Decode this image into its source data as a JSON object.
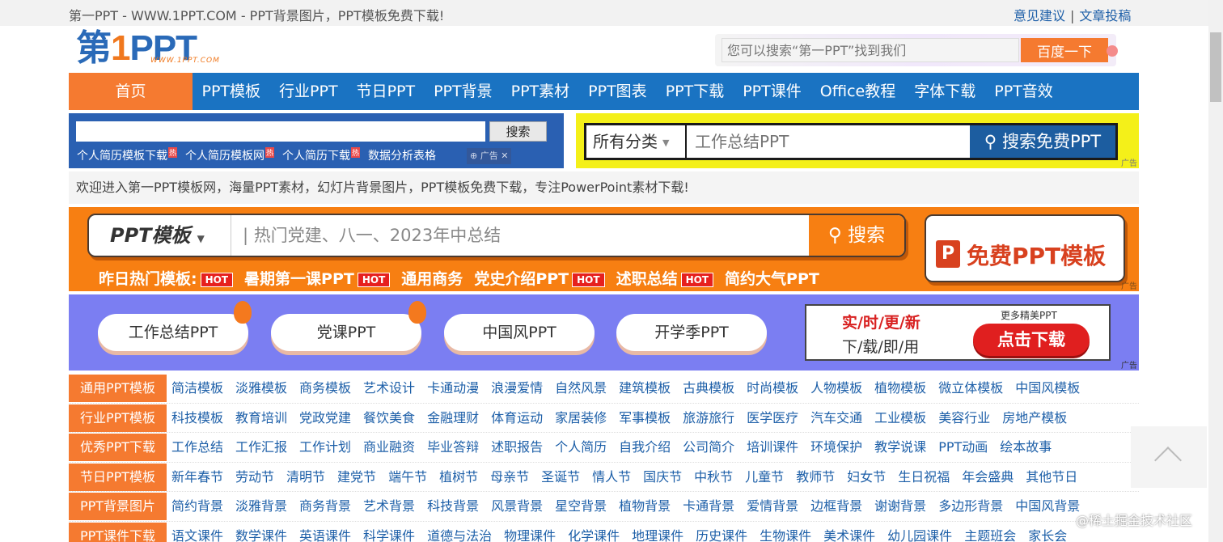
{
  "topbar": {
    "title": "第一PPT - WWW.1PPT.COM - PPT背景图片，PPT模板免费下载!",
    "link_feedback": "意见建议",
    "separator": "|",
    "link_submit": "文章投稿"
  },
  "logo": {
    "part1": "第",
    "part2": "1",
    "part3": "PPT",
    "sub": "WWW.1PPT.COM"
  },
  "header_search": {
    "placeholder": "您可以搜索“第一PPT”找到我们",
    "button": "百度一下"
  },
  "nav": {
    "home": "首页",
    "items": [
      "PPT模板",
      "行业PPT",
      "节日PPT",
      "PPT背景",
      "PPT素材",
      "PPT图表",
      "PPT下载",
      "PPT课件",
      "Office教程",
      "字体下载",
      "PPT音效"
    ]
  },
  "site_search": {
    "button": "搜索",
    "links": [
      "个人简历模板下载",
      "个人简历模板网",
      "个人简历下载",
      "数据分析表格"
    ],
    "hot_mark": "热",
    "ad_label": "广告",
    "ad_close": "✕"
  },
  "yellow_search": {
    "category": "所有分类",
    "placeholder": "工作总结PPT",
    "button": "搜索免费PPT",
    "ad": "广告"
  },
  "welcome": "欢迎进入第一PPT模板网，海量PPT素材，幻灯片背景图片，PPT模板免费下载，专注PowerPoint素材下载!",
  "orange_banner": {
    "category": "PPT模板",
    "placeholder": "热门党建、八一、2023年中总结",
    "button": "搜索",
    "hot_label": "昨日热门模板:",
    "hot_tag": "HOT",
    "hot_items": [
      "暑期第一课PPT",
      "通用商务",
      "党史介绍PPT",
      "述职总结",
      "简约大气PPT"
    ],
    "free_icon": "P",
    "free_text": "免费PPT模板",
    "ad": "广告"
  },
  "purple_banner": {
    "pills": [
      "工作总结PPT",
      "党课PPT",
      "中国风PPT",
      "开学季PPT"
    ],
    "line1": "实/时/更/新",
    "line2": "下/载/即/用",
    "more": "更多精美PPT",
    "download": "点击下载",
    "ad": "广告"
  },
  "categories": [
    {
      "head": "通用PPT模板",
      "links": [
        "简洁模板",
        "淡雅模板",
        "商务模板",
        "艺术设计",
        "卡通动漫",
        "浪漫爱情",
        "自然风景",
        "建筑模板",
        "古典模板",
        "时尚模板",
        "人物模板",
        "植物模板",
        "微立体模板",
        "中国风模板"
      ]
    },
    {
      "head": "行业PPT模板",
      "links": [
        "科技模板",
        "教育培训",
        "党政党建",
        "餐饮美食",
        "金融理财",
        "体育运动",
        "家居装修",
        "军事模板",
        "旅游旅行",
        "医学医疗",
        "汽车交通",
        "工业模板",
        "美容行业",
        "房地产模板"
      ]
    },
    {
      "head": "优秀PPT下载",
      "links": [
        "工作总结",
        "工作汇报",
        "工作计划",
        "商业融资",
        "毕业答辩",
        "述职报告",
        "个人简历",
        "自我介绍",
        "公司简介",
        "培训课件",
        "环境保护",
        "教学说课",
        "PPT动画",
        "绘本故事"
      ]
    },
    {
      "head": "节日PPT模板",
      "links": [
        "新年春节",
        "劳动节",
        "清明节",
        "建党节",
        "端午节",
        "植树节",
        "母亲节",
        "圣诞节",
        "情人节",
        "国庆节",
        "中秋节",
        "儿童节",
        "教师节",
        "妇女节",
        "生日祝福",
        "年会盛典",
        "其他节日"
      ]
    },
    {
      "head": "PPT背景图片",
      "links": [
        "简约背景",
        "淡雅背景",
        "商务背景",
        "艺术背景",
        "科技背景",
        "风景背景",
        "星空背景",
        "植物背景",
        "卡通背景",
        "爱情背景",
        "边框背景",
        "谢谢背景",
        "多边形背景",
        "中国风背景"
      ]
    },
    {
      "head": "PPT课件下载",
      "links": [
        "语文课件",
        "数学课件",
        "英语课件",
        "科学课件",
        "道德与法治",
        "物理课件",
        "化学课件",
        "地理课件",
        "历史课件",
        "生物课件",
        "美术课件",
        "幼儿园课件",
        "主题班会",
        "家长会"
      ]
    }
  ],
  "watermark": "@稀土掘金技术社区",
  "colors": {
    "nav_blue": "#1a73c2",
    "orange": "#f57a30",
    "yellow": "#f4f019",
    "purple": "#7b7ef2",
    "link_blue": "#1d5fa8"
  }
}
